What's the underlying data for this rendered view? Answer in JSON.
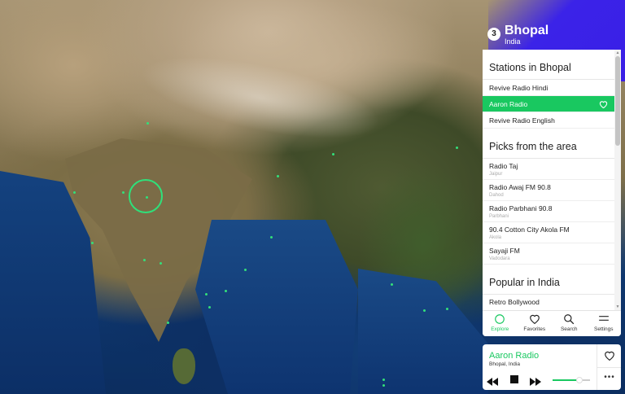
{
  "city": {
    "badge": "3",
    "name": "Bhopal",
    "country": "India"
  },
  "sections": {
    "stations_title": "Stations in Bhopal",
    "picks_title": "Picks from the area",
    "popular_title": "Popular in India"
  },
  "stations": [
    {
      "name": "Revive Radio Hindi",
      "active": false
    },
    {
      "name": "Aaron Radio",
      "active": true
    },
    {
      "name": "Revive Radio English",
      "active": false
    }
  ],
  "picks": [
    {
      "name": "Radio Taj",
      "city": "Jaipur"
    },
    {
      "name": "Radio Awaj FM 90.8",
      "city": "Dahod"
    },
    {
      "name": "Radio Parbhani 90.8",
      "city": "Parbhani"
    },
    {
      "name": "90.4 Cotton City Akola FM",
      "city": "Akola"
    },
    {
      "name": "Sayaji FM",
      "city": "Vadodara"
    }
  ],
  "popular": [
    {
      "name": "Retro Bollywood",
      "city": ""
    }
  ],
  "nav": {
    "explore": "Explore",
    "favorites": "Favorites",
    "search": "Search",
    "settings": "Settings"
  },
  "player": {
    "title": "Aaron Radio",
    "subtitle": "Bhopal, India",
    "volume": 0.72
  },
  "colors": {
    "accent": "#19c860",
    "header_bg": "#3a1fe6"
  },
  "icons": {
    "explore": "compass-icon",
    "favorites": "heart-icon",
    "search": "search-icon",
    "settings": "menu-icon"
  }
}
